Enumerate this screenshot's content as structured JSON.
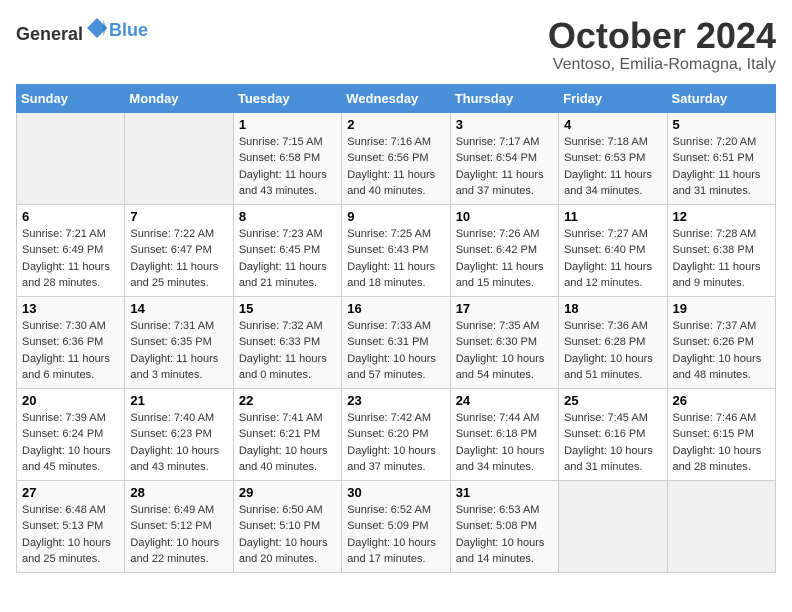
{
  "header": {
    "logo_general": "General",
    "logo_blue": "Blue",
    "month_title": "October 2024",
    "location": "Ventoso, Emilia-Romagna, Italy"
  },
  "days_of_week": [
    "Sunday",
    "Monday",
    "Tuesday",
    "Wednesday",
    "Thursday",
    "Friday",
    "Saturday"
  ],
  "weeks": [
    [
      {
        "day": "",
        "sunrise": "",
        "sunset": "",
        "daylight": ""
      },
      {
        "day": "",
        "sunrise": "",
        "sunset": "",
        "daylight": ""
      },
      {
        "day": "1",
        "sunrise": "Sunrise: 7:15 AM",
        "sunset": "Sunset: 6:58 PM",
        "daylight": "Daylight: 11 hours and 43 minutes."
      },
      {
        "day": "2",
        "sunrise": "Sunrise: 7:16 AM",
        "sunset": "Sunset: 6:56 PM",
        "daylight": "Daylight: 11 hours and 40 minutes."
      },
      {
        "day": "3",
        "sunrise": "Sunrise: 7:17 AM",
        "sunset": "Sunset: 6:54 PM",
        "daylight": "Daylight: 11 hours and 37 minutes."
      },
      {
        "day": "4",
        "sunrise": "Sunrise: 7:18 AM",
        "sunset": "Sunset: 6:53 PM",
        "daylight": "Daylight: 11 hours and 34 minutes."
      },
      {
        "day": "5",
        "sunrise": "Sunrise: 7:20 AM",
        "sunset": "Sunset: 6:51 PM",
        "daylight": "Daylight: 11 hours and 31 minutes."
      }
    ],
    [
      {
        "day": "6",
        "sunrise": "Sunrise: 7:21 AM",
        "sunset": "Sunset: 6:49 PM",
        "daylight": "Daylight: 11 hours and 28 minutes."
      },
      {
        "day": "7",
        "sunrise": "Sunrise: 7:22 AM",
        "sunset": "Sunset: 6:47 PM",
        "daylight": "Daylight: 11 hours and 25 minutes."
      },
      {
        "day": "8",
        "sunrise": "Sunrise: 7:23 AM",
        "sunset": "Sunset: 6:45 PM",
        "daylight": "Daylight: 11 hours and 21 minutes."
      },
      {
        "day": "9",
        "sunrise": "Sunrise: 7:25 AM",
        "sunset": "Sunset: 6:43 PM",
        "daylight": "Daylight: 11 hours and 18 minutes."
      },
      {
        "day": "10",
        "sunrise": "Sunrise: 7:26 AM",
        "sunset": "Sunset: 6:42 PM",
        "daylight": "Daylight: 11 hours and 15 minutes."
      },
      {
        "day": "11",
        "sunrise": "Sunrise: 7:27 AM",
        "sunset": "Sunset: 6:40 PM",
        "daylight": "Daylight: 11 hours and 12 minutes."
      },
      {
        "day": "12",
        "sunrise": "Sunrise: 7:28 AM",
        "sunset": "Sunset: 6:38 PM",
        "daylight": "Daylight: 11 hours and 9 minutes."
      }
    ],
    [
      {
        "day": "13",
        "sunrise": "Sunrise: 7:30 AM",
        "sunset": "Sunset: 6:36 PM",
        "daylight": "Daylight: 11 hours and 6 minutes."
      },
      {
        "day": "14",
        "sunrise": "Sunrise: 7:31 AM",
        "sunset": "Sunset: 6:35 PM",
        "daylight": "Daylight: 11 hours and 3 minutes."
      },
      {
        "day": "15",
        "sunrise": "Sunrise: 7:32 AM",
        "sunset": "Sunset: 6:33 PM",
        "daylight": "Daylight: 11 hours and 0 minutes."
      },
      {
        "day": "16",
        "sunrise": "Sunrise: 7:33 AM",
        "sunset": "Sunset: 6:31 PM",
        "daylight": "Daylight: 10 hours and 57 minutes."
      },
      {
        "day": "17",
        "sunrise": "Sunrise: 7:35 AM",
        "sunset": "Sunset: 6:30 PM",
        "daylight": "Daylight: 10 hours and 54 minutes."
      },
      {
        "day": "18",
        "sunrise": "Sunrise: 7:36 AM",
        "sunset": "Sunset: 6:28 PM",
        "daylight": "Daylight: 10 hours and 51 minutes."
      },
      {
        "day": "19",
        "sunrise": "Sunrise: 7:37 AM",
        "sunset": "Sunset: 6:26 PM",
        "daylight": "Daylight: 10 hours and 48 minutes."
      }
    ],
    [
      {
        "day": "20",
        "sunrise": "Sunrise: 7:39 AM",
        "sunset": "Sunset: 6:24 PM",
        "daylight": "Daylight: 10 hours and 45 minutes."
      },
      {
        "day": "21",
        "sunrise": "Sunrise: 7:40 AM",
        "sunset": "Sunset: 6:23 PM",
        "daylight": "Daylight: 10 hours and 43 minutes."
      },
      {
        "day": "22",
        "sunrise": "Sunrise: 7:41 AM",
        "sunset": "Sunset: 6:21 PM",
        "daylight": "Daylight: 10 hours and 40 minutes."
      },
      {
        "day": "23",
        "sunrise": "Sunrise: 7:42 AM",
        "sunset": "Sunset: 6:20 PM",
        "daylight": "Daylight: 10 hours and 37 minutes."
      },
      {
        "day": "24",
        "sunrise": "Sunrise: 7:44 AM",
        "sunset": "Sunset: 6:18 PM",
        "daylight": "Daylight: 10 hours and 34 minutes."
      },
      {
        "day": "25",
        "sunrise": "Sunrise: 7:45 AM",
        "sunset": "Sunset: 6:16 PM",
        "daylight": "Daylight: 10 hours and 31 minutes."
      },
      {
        "day": "26",
        "sunrise": "Sunrise: 7:46 AM",
        "sunset": "Sunset: 6:15 PM",
        "daylight": "Daylight: 10 hours and 28 minutes."
      }
    ],
    [
      {
        "day": "27",
        "sunrise": "Sunrise: 6:48 AM",
        "sunset": "Sunset: 5:13 PM",
        "daylight": "Daylight: 10 hours and 25 minutes."
      },
      {
        "day": "28",
        "sunrise": "Sunrise: 6:49 AM",
        "sunset": "Sunset: 5:12 PM",
        "daylight": "Daylight: 10 hours and 22 minutes."
      },
      {
        "day": "29",
        "sunrise": "Sunrise: 6:50 AM",
        "sunset": "Sunset: 5:10 PM",
        "daylight": "Daylight: 10 hours and 20 minutes."
      },
      {
        "day": "30",
        "sunrise": "Sunrise: 6:52 AM",
        "sunset": "Sunset: 5:09 PM",
        "daylight": "Daylight: 10 hours and 17 minutes."
      },
      {
        "day": "31",
        "sunrise": "Sunrise: 6:53 AM",
        "sunset": "Sunset: 5:08 PM",
        "daylight": "Daylight: 10 hours and 14 minutes."
      },
      {
        "day": "",
        "sunrise": "",
        "sunset": "",
        "daylight": ""
      },
      {
        "day": "",
        "sunrise": "",
        "sunset": "",
        "daylight": ""
      }
    ]
  ]
}
